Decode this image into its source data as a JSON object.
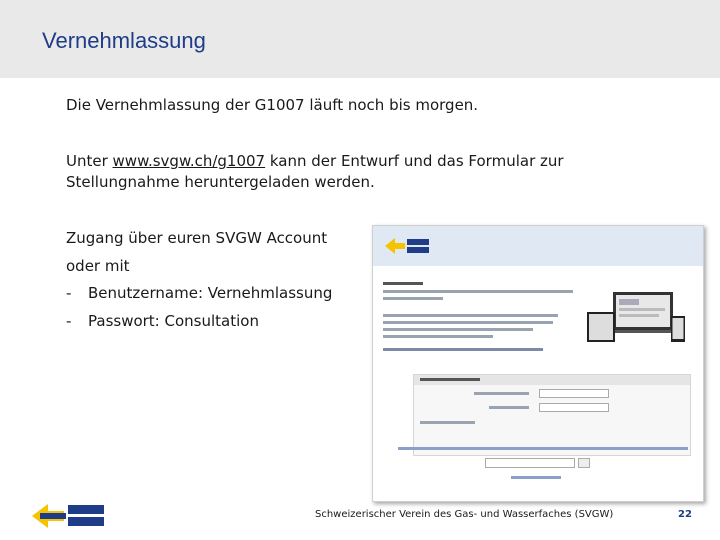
{
  "slide": {
    "title": "Vernehmlassung",
    "line1": "Die Vernehmlassung der G1007 läuft noch bis morgen.",
    "line2_pre": "Unter ",
    "line2_link": "www.svgw.ch/g1007",
    "line2_post": " kann der Entwurf und das Formular zur Stellungnahme heruntergeladen werden.",
    "line3": "Zugang über euren SVGW Account",
    "line4": "oder mit",
    "bullets": [
      {
        "dash": "-",
        "text": "Benutzername: Vernehmlassung"
      },
      {
        "dash": "-",
        "text": "Passwort: Consultation"
      }
    ]
  },
  "footer": {
    "org": "Schweizerischer Verein des Gas- und Wasserfaches (SVGW)",
    "page": "22"
  },
  "colors": {
    "brand_blue": "#1f3c88",
    "brand_yellow": "#f5c400",
    "title_bar": "#e9e9e9"
  }
}
